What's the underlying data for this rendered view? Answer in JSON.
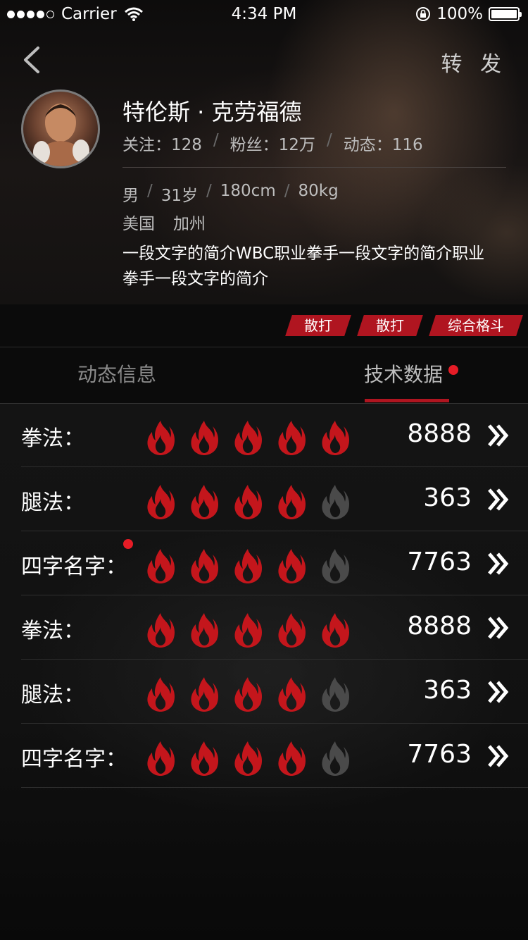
{
  "status_bar": {
    "carrier": "Carrier",
    "time": "4:34 PM",
    "battery": "100%"
  },
  "header": {
    "share_label": "转 发"
  },
  "profile": {
    "name": "特伦斯 · 克劳福德",
    "stats": [
      "关注：128",
      "粉丝：12万",
      "动态：116"
    ],
    "attributes": [
      "男",
      "31岁",
      "180cm",
      "80kg"
    ],
    "location": [
      "美国",
      "加州"
    ],
    "bio": "一段文字的简介WBC职业拳手一段文字的简介职业拳手一段文字的简介"
  },
  "tags": [
    "散打",
    "散打",
    "综合格斗"
  ],
  "tabs": [
    {
      "label": "动态信息",
      "active": false
    },
    {
      "label": "技术数据",
      "active": true,
      "has_dot": true
    }
  ],
  "skills": [
    {
      "label": "拳法：",
      "rating": 5,
      "max": 5,
      "value": "8888"
    },
    {
      "label": "腿法：",
      "rating": 4,
      "max": 5,
      "value": "363"
    },
    {
      "label": "四字名字：",
      "rating": 4,
      "max": 5,
      "value": "7763",
      "has_dot": true
    },
    {
      "label": "拳法：",
      "rating": 5,
      "max": 5,
      "value": "8888"
    },
    {
      "label": "腿法：",
      "rating": 4,
      "max": 5,
      "value": "363"
    },
    {
      "label": "四字名字：",
      "rating": 4,
      "max": 5,
      "value": "7763"
    }
  ],
  "colors": {
    "accent": "#b01520",
    "flame_active": "#c4161c",
    "flame_inactive": "#4a4a4a",
    "dot": "#e61c26"
  }
}
